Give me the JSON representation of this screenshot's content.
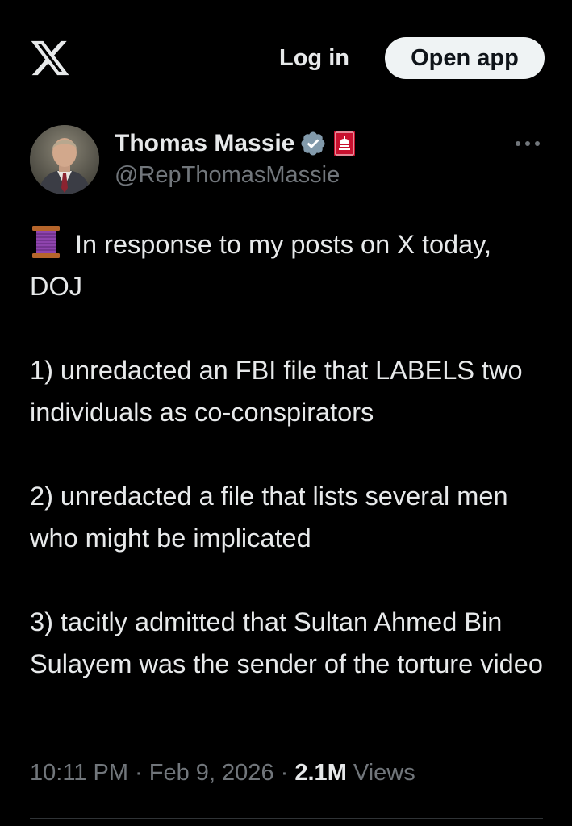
{
  "header": {
    "logo_icon": "x-logo-icon",
    "login_label": "Log in",
    "open_app_label": "Open app"
  },
  "author": {
    "name": "Thomas Massie",
    "handle": "@RepThomasMassie",
    "verified_icon": "verified-badge-icon",
    "affiliation_icon": "government-badge-icon",
    "more_icon": "more-options-icon"
  },
  "tweet": {
    "emoji_icon": "thread-spool-icon",
    "paragraphs": [
      "In response to my posts on X today, DOJ",
      "1) unredacted an FBI file that LABELS two individuals as co-conspirators",
      "2) unredacted a file that lists several men who might be implicated",
      "3) tacitly admitted that Sultan Ahmed Bin Sulayem was the sender of the torture video"
    ]
  },
  "meta": {
    "time": "10:11 PM",
    "separator": "·",
    "date": "Feb 9, 2026",
    "views_count": "2.1M",
    "views_label": "Views"
  },
  "colors": {
    "background": "#000000",
    "text_primary": "#e7e9ea",
    "text_secondary": "#71767b",
    "verified_blue": "#829aab",
    "button_bg": "#eff3f4",
    "divider": "#2f3336"
  }
}
